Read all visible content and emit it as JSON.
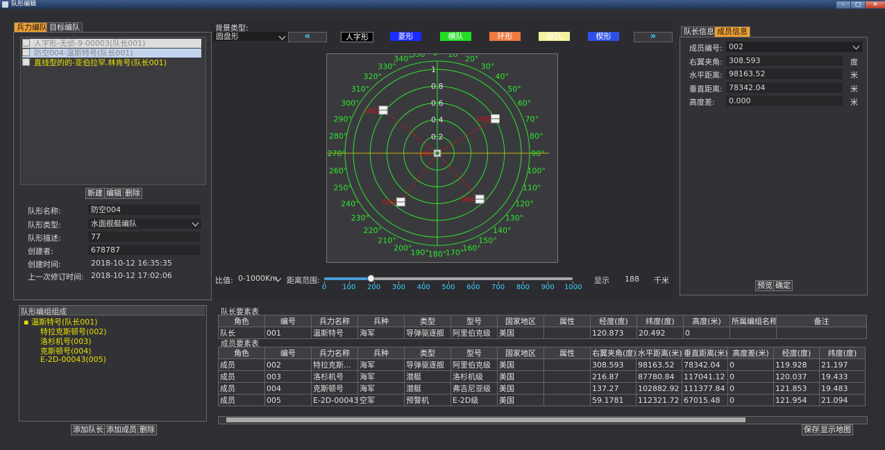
{
  "window": {
    "title": "队形编辑"
  },
  "left": {
    "tabs": [
      {
        "label": "兵力编队"
      },
      {
        "label": "目标编队"
      }
    ],
    "formations": [
      {
        "label": "人字形-无侦-9-00003(队长001)"
      },
      {
        "label": "防空004-温斯特号(队长001)"
      },
      {
        "label": "直线型的的-亚伯拉罕.林肯号(队长001)"
      }
    ],
    "actions": {
      "new": "新建",
      "edit": "编辑",
      "delete": "删除"
    },
    "form": {
      "name_label": "队形名称:",
      "name_value": "防空004",
      "type_label": "队形类型:",
      "type_value": "水面舰艇编队",
      "desc_label": "队形描述:",
      "desc_value": "77",
      "creator_label": "创建者:",
      "creator_value": "678787",
      "created_label": "创建时间:",
      "created_value": "2018-10-12 16:35:35",
      "modified_label": "上一次修订时间:",
      "modified_value": "2018-10-12 17:02:06"
    }
  },
  "composition": {
    "title": "队形编组组成",
    "leader": "温斯特号(队长001)",
    "members": [
      {
        "label": "特拉克斯顿号(002)"
      },
      {
        "label": "洛杉机号(003)"
      },
      {
        "label": "克斯顿号(004)"
      },
      {
        "label": "E-2D-00043(005)"
      }
    ],
    "add_leader": "添加队长",
    "add_member": "添加成员",
    "delete": "删除"
  },
  "center": {
    "bg_label": "背景类型:",
    "bg_value": "圆盘形",
    "shapes": [
      {
        "label": "人字形",
        "color": "#000000",
        "text": "#ffffff"
      },
      {
        "label": "菱形",
        "color": "#1a2cff",
        "text": "#ffffff"
      },
      {
        "label": "横队",
        "color": "#22dd22",
        "text": "#ffffff"
      },
      {
        "label": "环形",
        "color": "#f07a40",
        "text": "#ffffff"
      },
      {
        "label": "纵队",
        "color": "#f5f0a0",
        "text": "#ffffff"
      },
      {
        "label": "楔形",
        "color": "#2f50e8",
        "text": "#ffffff"
      }
    ],
    "scale_label": "比值:",
    "scale_value": "0-1000Km",
    "range_label": "距离范围:",
    "slider_ticks": [
      "0",
      "100",
      "200",
      "300",
      "400",
      "500",
      "600",
      "700",
      "800",
      "900",
      "1000"
    ],
    "slider_value": 188,
    "display_label": "显示",
    "display_value": "188",
    "unit": "千米"
  },
  "polar": {
    "rings": [
      "0.2",
      "0.4",
      "0.6",
      "0.8",
      "1"
    ],
    "zero_label": "0°",
    "angle_labels": [
      "10°",
      "20°",
      "30°",
      "40°",
      "50°",
      "60°",
      "70°",
      "80°",
      "90°",
      "100°",
      "110°",
      "120°",
      "130°",
      "140°",
      "150°",
      "160°",
      "170°",
      "180°",
      "190°",
      "200°",
      "210°",
      "220°",
      "230°",
      "240°",
      "250°",
      "260°",
      "270°",
      "280°",
      "290°",
      "300°",
      "310°",
      "320°",
      "330°",
      "340°",
      "350°"
    ],
    "members": [
      {
        "code": "002",
        "angle": 308.593,
        "distance": 0.42
      },
      {
        "code": "003",
        "angle": 216.87,
        "distance": 0.37
      },
      {
        "code": "004",
        "angle": 137.27,
        "distance": 0.38
      },
      {
        "code": "005",
        "angle": 59.1781,
        "distance": 0.41
      }
    ],
    "leader_code": "001"
  },
  "right": {
    "tabs": [
      {
        "label": "队长信息"
      },
      {
        "label": "成员信息"
      }
    ],
    "member_label": "成员编号:",
    "member_value": "002",
    "angle_label": "右翼夹角:",
    "angle_value": "308.593",
    "angle_unit": "度",
    "hdist_label": "水平距离:",
    "hdist_value": "98163.52",
    "hdist_unit": "米",
    "vdist_label": "垂直距离:",
    "vdist_value": "78342.04",
    "vdist_unit": "米",
    "height_label": "高度差:",
    "height_value": "0.000",
    "height_unit": "米",
    "preview": "预览",
    "confirm": "确定"
  },
  "leader_table": {
    "title": "队长要素表",
    "headers": [
      "角色",
      "编号",
      "兵力名称",
      "兵种",
      "类型",
      "型号",
      "国家地区",
      "属性",
      "经度(度)",
      "纬度(度)",
      "高度(米)",
      "所属编组名称",
      "备注"
    ],
    "rows": [
      [
        "队长",
        "001",
        "温斯特号",
        "海军",
        "导弹驱逐舰",
        "阿里伯克级",
        "美国",
        "",
        "120.873",
        "20.492",
        "0",
        "",
        ""
      ]
    ]
  },
  "member_table": {
    "title": "成员要素表",
    "headers": [
      "角色",
      "编号",
      "兵力名称",
      "兵种",
      "类型",
      "型号",
      "国家地区",
      "属性",
      "右翼夹角(度)",
      "水平距离(米)",
      "垂直距离(米)",
      "高度差(米)",
      "经度(度)",
      "纬度(度)"
    ],
    "rows": [
      [
        "成员",
        "002",
        "特拉克斯...",
        "海军",
        "导弹驱逐舰",
        "阿里伯克级",
        "美国",
        "",
        "308.593",
        "98163.52",
        "78342.04",
        "0",
        "119.928",
        "21.197"
      ],
      [
        "成员",
        "003",
        "洛杉机号",
        "海军",
        "潜艇",
        "洛杉机级",
        "美国",
        "",
        "216.87",
        "87780.84",
        "117041.12",
        "0",
        "120.037",
        "19.433"
      ],
      [
        "成员",
        "004",
        "克斯顿号",
        "海军",
        "潜艇",
        "弗吉尼亚级",
        "美国",
        "",
        "137.27",
        "102882.92",
        "111377.84",
        "0",
        "121.853",
        "19.483"
      ],
      [
        "成员",
        "005",
        "E-2D-00043",
        "空军",
        "预警机",
        "E-2D级",
        "美国",
        "",
        "59.1781",
        "112321.72",
        "67015.48",
        "0",
        "121.954",
        "21.094"
      ]
    ]
  },
  "footer": {
    "save": "保存",
    "show_map": "显示地图"
  }
}
